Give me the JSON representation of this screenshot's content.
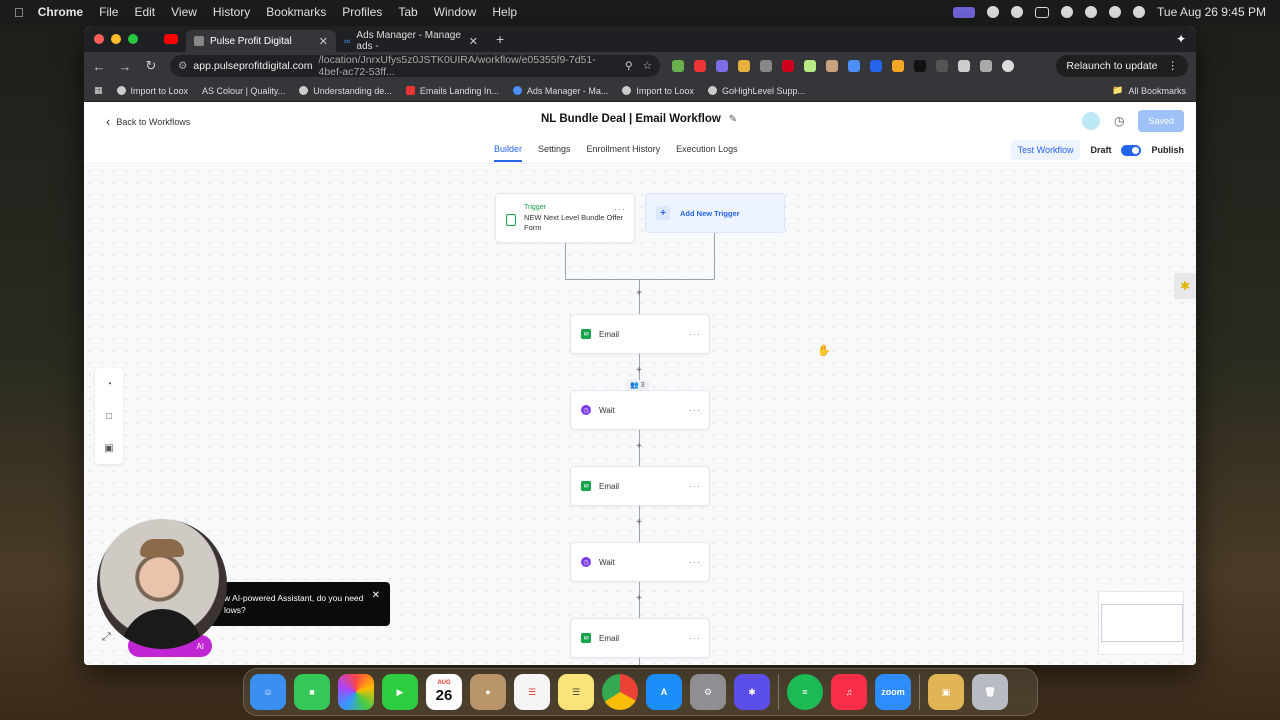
{
  "menubar": {
    "app_name": "Chrome",
    "menus": [
      "File",
      "Edit",
      "View",
      "History",
      "Bookmarks",
      "Profiles",
      "Tab",
      "Window",
      "Help"
    ],
    "datetime": "Tue Aug 26  9:45 PM"
  },
  "browser": {
    "tabs": [
      {
        "title": "Pulse Profit Digital",
        "active": true
      },
      {
        "title": "Ads Manager - Manage ads -",
        "active": false
      }
    ],
    "url_host": "app.pulseprofitdigital.com",
    "url_path": "/location/JnrxUfys5z0JSTK0UIRA/workflow/e05355f9-7d51-4bef-ac72-53ff...",
    "relaunch_label": "Relaunch to update",
    "bookmarks": [
      "Import to Loox",
      "AS Colour | Quality...",
      "Understanding de...",
      "Emails Landing In...",
      "Ads Manager - Ma...",
      "Import to Loox",
      "GoHighLevel Supp..."
    ],
    "all_bookmarks_label": "All Bookmarks"
  },
  "header": {
    "back_label": "Back to Workflows",
    "workflow_title": "NL Bundle Deal | Email Workflow",
    "saved_label": "Saved",
    "tabs": [
      "Builder",
      "Settings",
      "Enrollment History",
      "Execution Logs"
    ],
    "active_tab": "Builder",
    "test_label": "Test Workflow",
    "draft_label": "Draft",
    "publish_label": "Publish",
    "publish_toggle": true
  },
  "canvas": {
    "trigger": {
      "label": "Trigger",
      "name": "NEW Next Level Bundle Offer Form"
    },
    "add_trigger_label": "Add New Trigger",
    "enrolled_count": "3",
    "steps": [
      {
        "type": "email",
        "label": "Email"
      },
      {
        "type": "wait",
        "label": "Wait"
      },
      {
        "type": "email",
        "label": "Email"
      },
      {
        "type": "wait",
        "label": "Wait"
      },
      {
        "type": "email",
        "label": "Email"
      }
    ]
  },
  "assistant": {
    "message_line1": "w AI-powered Assistant, do you need",
    "message_line2": "lows?",
    "button_label": "AI"
  },
  "dock": {
    "apps": [
      "Finder",
      "Messages",
      "Photos",
      "FaceTime",
      "Calendar",
      "Contacts",
      "Reminders",
      "Notes",
      "Chrome",
      "App Store",
      "System Settings",
      "Perplexity",
      "Spotify",
      "Music",
      "Zoom",
      "Archive Utility",
      "Trash"
    ],
    "calendar_month": "AUG",
    "calendar_day": "26",
    "zoom_label": "zoom"
  }
}
